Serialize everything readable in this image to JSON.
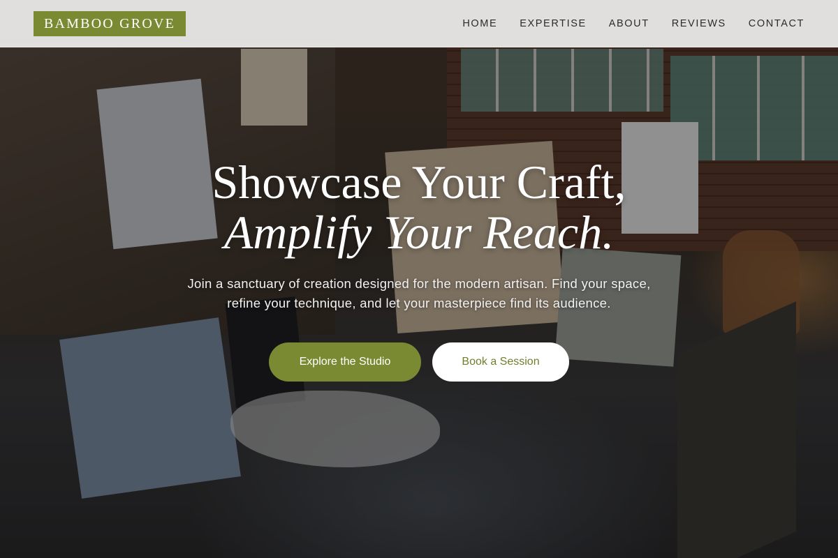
{
  "brand": {
    "name": "BAMBOO GROVE",
    "accent_color": "#7a8a33"
  },
  "nav": {
    "items": [
      {
        "label": "HOME"
      },
      {
        "label": "EXPERTISE"
      },
      {
        "label": "ABOUT"
      },
      {
        "label": "REVIEWS"
      },
      {
        "label": "CONTACT"
      }
    ]
  },
  "hero": {
    "headline_line1": "Showcase Your Craft,",
    "headline_line2": "Amplify Your Reach.",
    "subtext": "Join a sanctuary of creation designed for the modern artisan. Find your space, refine your technique, and let your masterpiece find its audience.",
    "primary_cta": "Explore the Studio",
    "secondary_cta": "Book a Session",
    "background": "art studio photo with canvases, brick wall and windows"
  }
}
